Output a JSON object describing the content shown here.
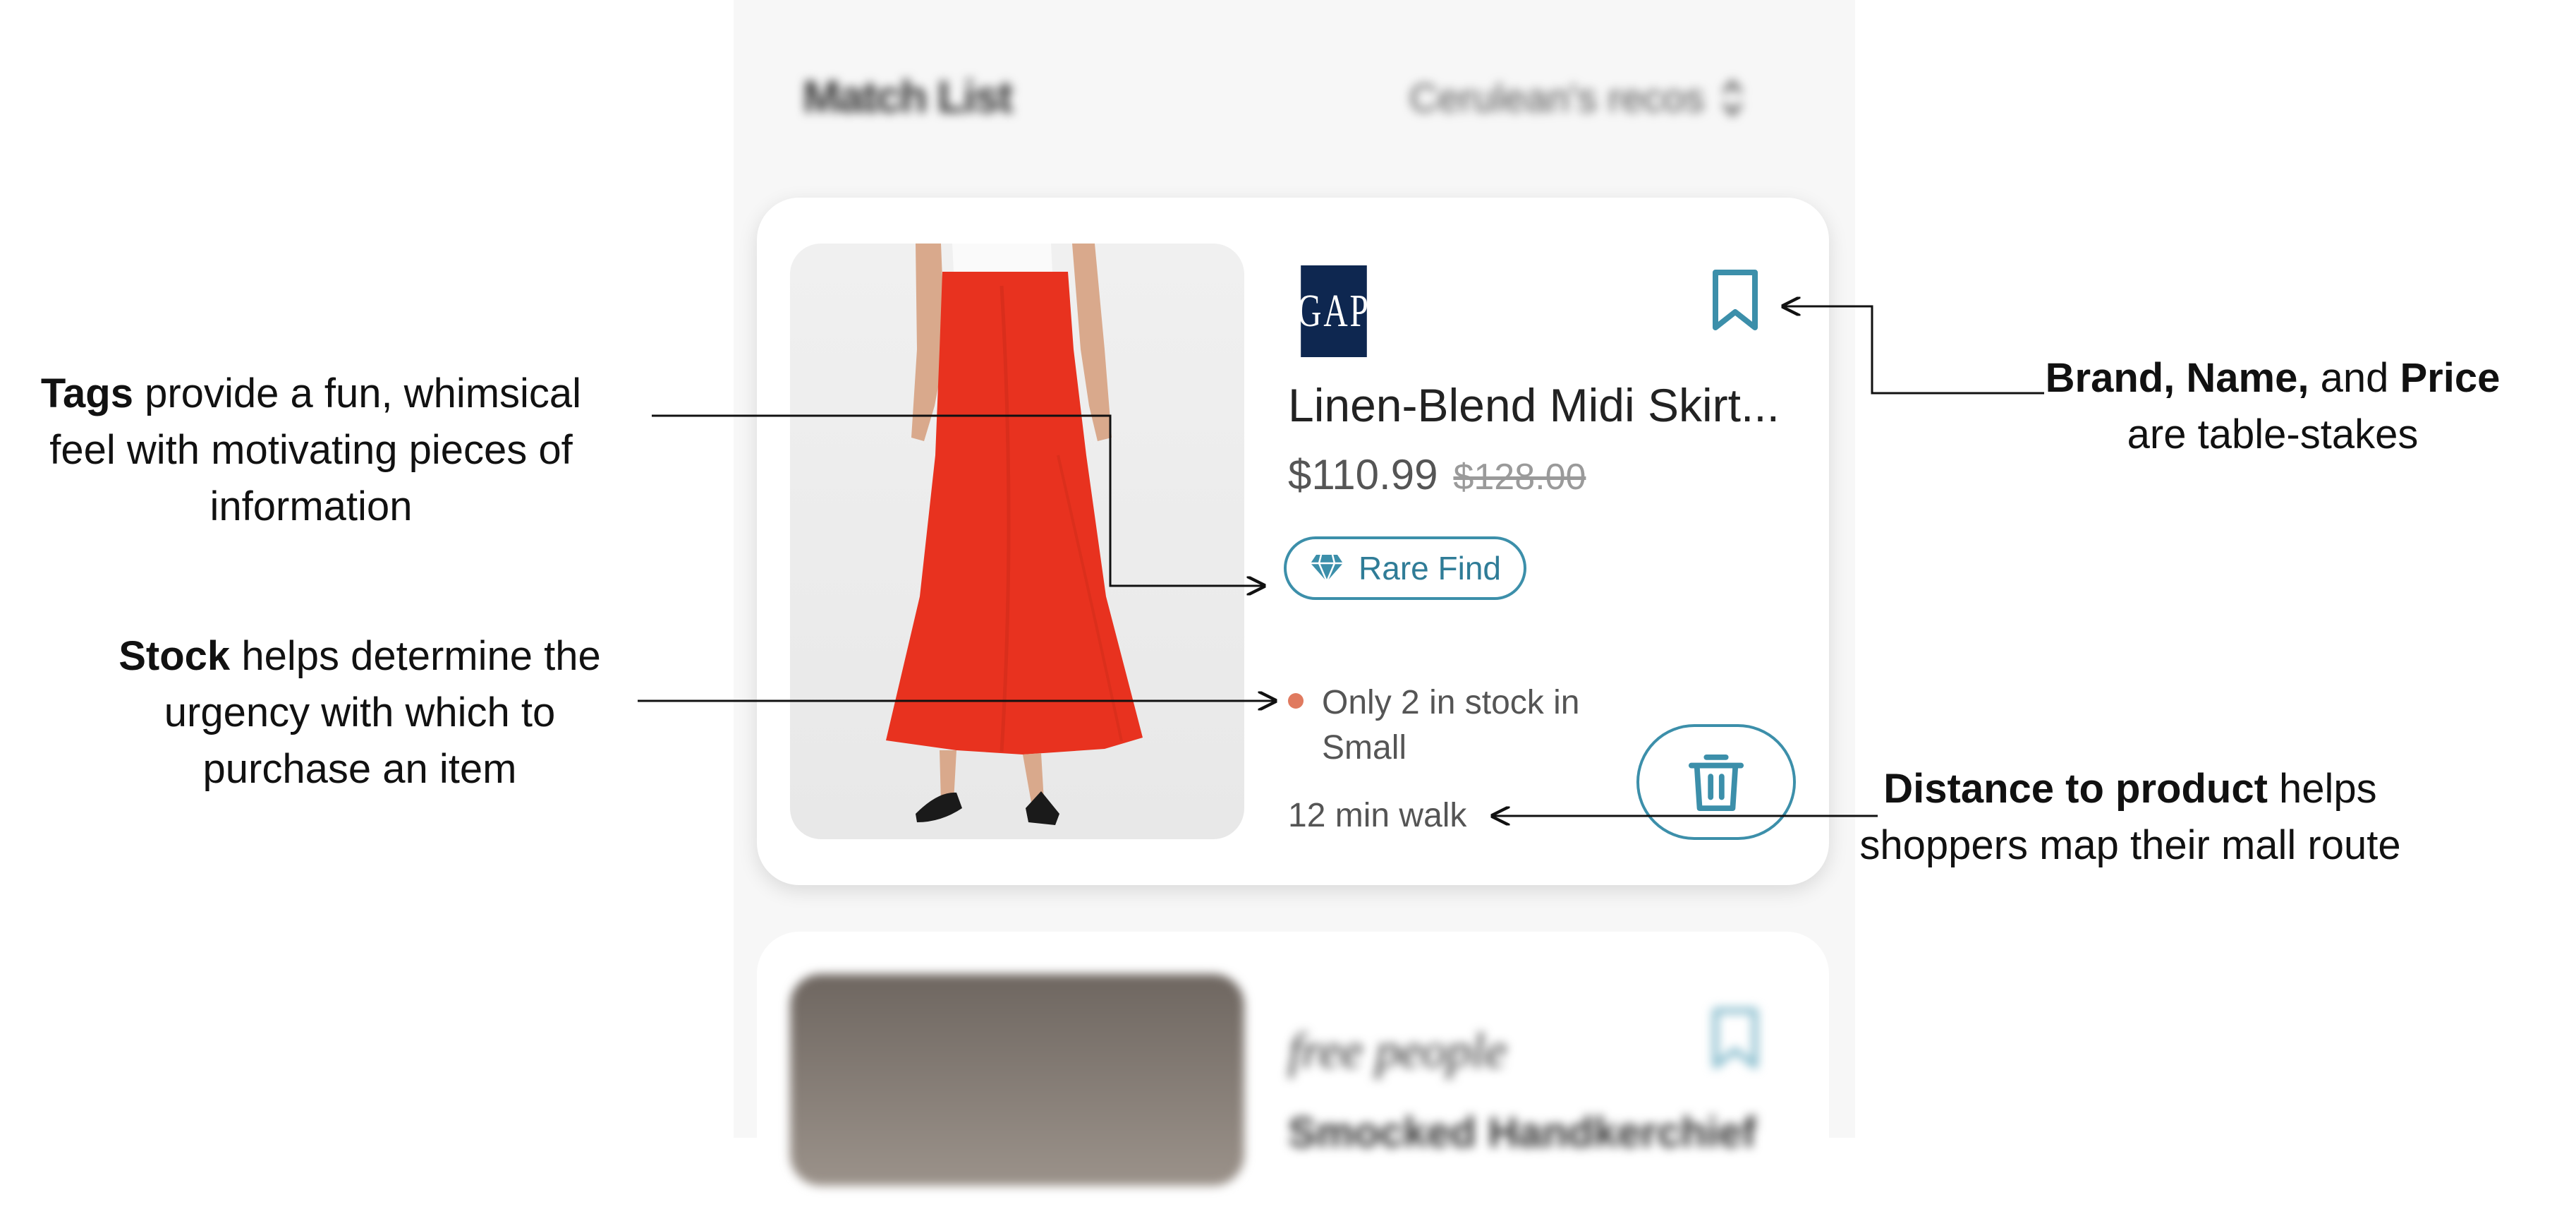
{
  "header": {
    "title": "Match List",
    "list_selector": "Cerulean's recos"
  },
  "product": {
    "brand": "GAP",
    "name": "Linen-Blend Midi Skirt...",
    "price_sale": "$110.99",
    "price_original": "$128.00",
    "tag_label": "Rare Find",
    "stock_text": "Only 2 in stock in Small",
    "distance": "12 min walk"
  },
  "next_product": {
    "brand": "free people",
    "name": "Smocked Handkerchief"
  },
  "annotations": {
    "tags": {
      "strong": "Tags",
      "rest": " provide a fun, whimsical feel with motivating pieces of information"
    },
    "stock": {
      "strong": "Stock",
      "rest": " helps determine the urgency with which to purchase an item"
    },
    "brand": {
      "strong1": "Brand, Name,",
      "mid": " and ",
      "strong2": "Price",
      "rest": " are table-stakes"
    },
    "distance": {
      "strong": "Distance to product",
      "rest": " helps shoppers map their mall route"
    }
  },
  "colors": {
    "accent_teal": "#3c8faa",
    "gap_navy": "#0e2750",
    "skirt_red": "#e8321f",
    "stock_dot": "#e07a5f"
  },
  "icons": [
    "chevron-updown-icon",
    "bookmark-icon",
    "diamond-icon",
    "trash-icon"
  ]
}
